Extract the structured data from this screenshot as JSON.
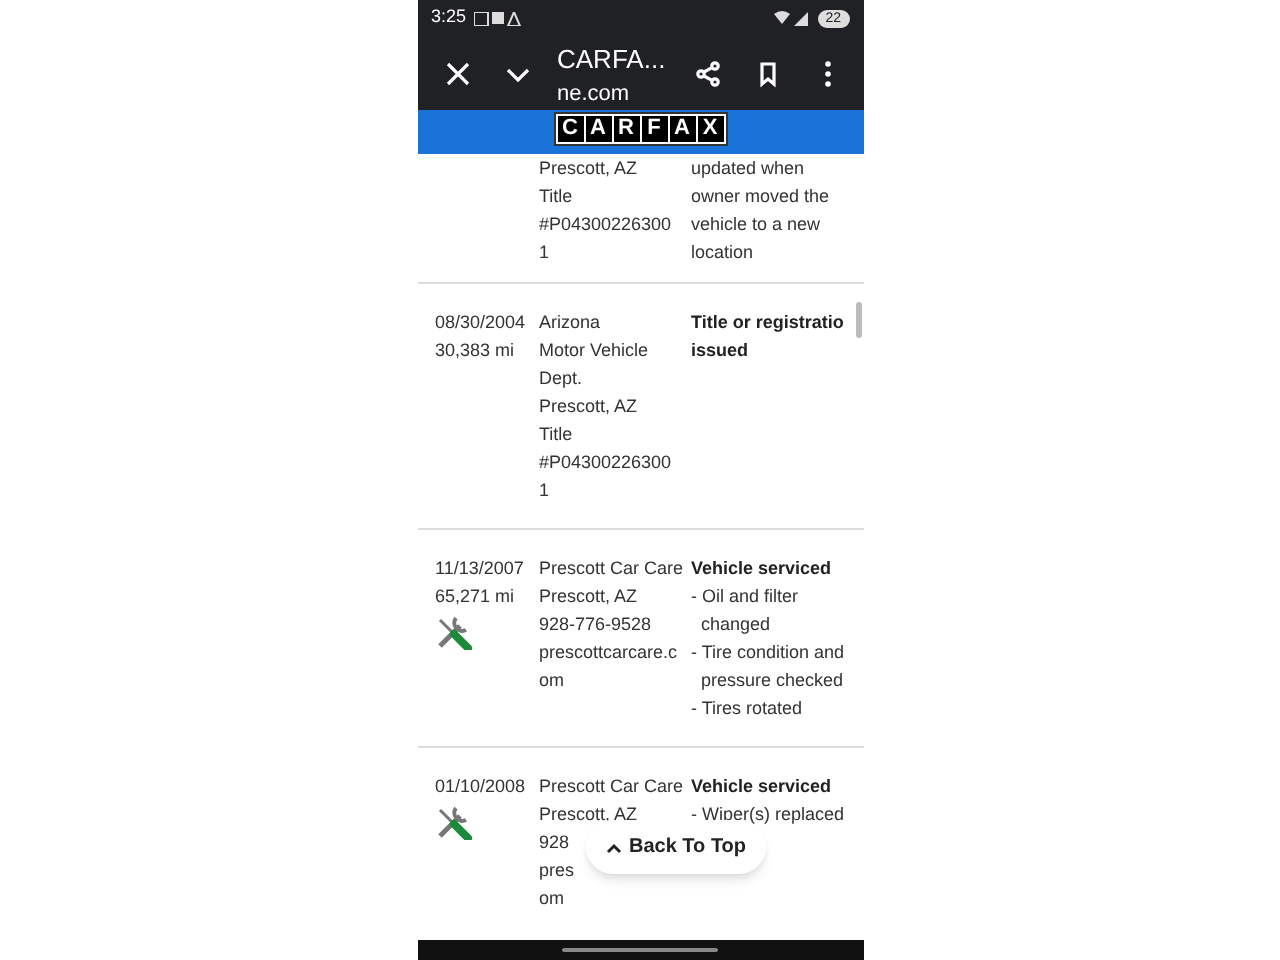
{
  "status_bar": {
    "time": "3:25",
    "battery": "22"
  },
  "toolbar": {
    "title": "CARFA...",
    "url": "ne.com"
  },
  "banner": {
    "logo_letters": [
      "C",
      "A",
      "R",
      "F",
      "A",
      "X"
    ]
  },
  "records": [
    {
      "service_icon": false,
      "source": [
        "Prescott, AZ",
        "Title",
        "#P04300226300",
        "1"
      ],
      "details": [
        {
          "lines": [
            "updated when",
            "owner moved the",
            "vehicle to a new",
            "location"
          ],
          "kind": "text"
        }
      ]
    },
    {
      "date": "08/30/2004",
      "odometer": "30,383 mi",
      "service_icon": false,
      "source": [
        "Arizona",
        "Motor Vehicle",
        "Dept.",
        "Prescott, AZ",
        "Title",
        "#P04300226300",
        "1"
      ],
      "title": [
        "Title or registratio",
        "issued"
      ]
    },
    {
      "date": "11/13/2007",
      "odometer": "65,271 mi",
      "service_icon": true,
      "source": [
        "Prescott Car Care",
        "Prescott, AZ",
        "928-776-9528",
        "prescottcarcare.c",
        "om"
      ],
      "title": [
        "Vehicle serviced"
      ],
      "details": [
        {
          "lines": [
            "- Oil and filter",
            "changed"
          ],
          "kind": "bullet"
        },
        {
          "lines": [
            "- Tire condition and",
            "pressure checked"
          ],
          "kind": "bullet"
        },
        {
          "lines": [
            "- Tires rotated"
          ],
          "kind": "bullet"
        }
      ]
    },
    {
      "date": "01/10/2008",
      "service_icon": true,
      "source": [
        "Prescott Car Care",
        "Prescott, AZ",
        "928",
        "pres",
        "om"
      ],
      "title": [
        "Vehicle serviced"
      ],
      "details": [
        {
          "lines": [
            "- Wiper(s) replaced"
          ],
          "kind": "bullet"
        }
      ]
    }
  ],
  "back_to_top": {
    "label": "Back To Top"
  }
}
